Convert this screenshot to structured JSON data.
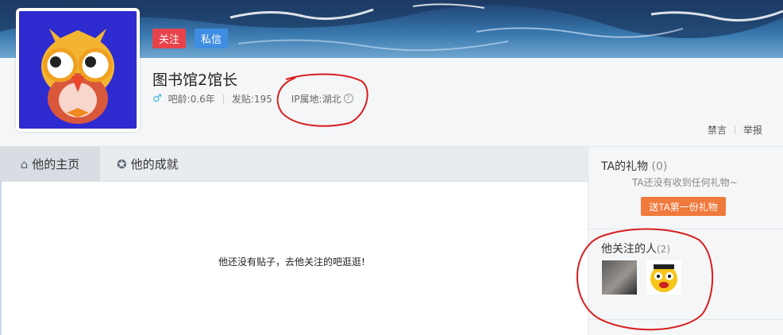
{
  "profile": {
    "follow_label": "关注",
    "message_label": "私信",
    "username": "图书馆2馆长",
    "gender_icon": "male-icon",
    "age": "吧龄:0.6年",
    "posts": "发贴:195",
    "ip": "IP属地:湖北",
    "help_glyph": "?"
  },
  "actions": {
    "mute": "禁言",
    "report": "举报"
  },
  "tabs": [
    {
      "label": "他的主页",
      "icon": "home-icon"
    },
    {
      "label": "他的成就",
      "icon": "medal-icon"
    }
  ],
  "main": {
    "empty_text": "他还没有贴子，去他关注的吧逛逛!"
  },
  "gifts": {
    "title": "TA的礼物",
    "count": "(0)",
    "empty": "TA还没有收到任何礼物~",
    "button": "送TA第一份礼物"
  },
  "following": {
    "title": "他关注的人",
    "count": "(2)"
  },
  "colors": {
    "follow": "#e8434a",
    "message": "#3e8de0",
    "gift_button": "#f07a3c",
    "annotation": "#d81e1e"
  }
}
